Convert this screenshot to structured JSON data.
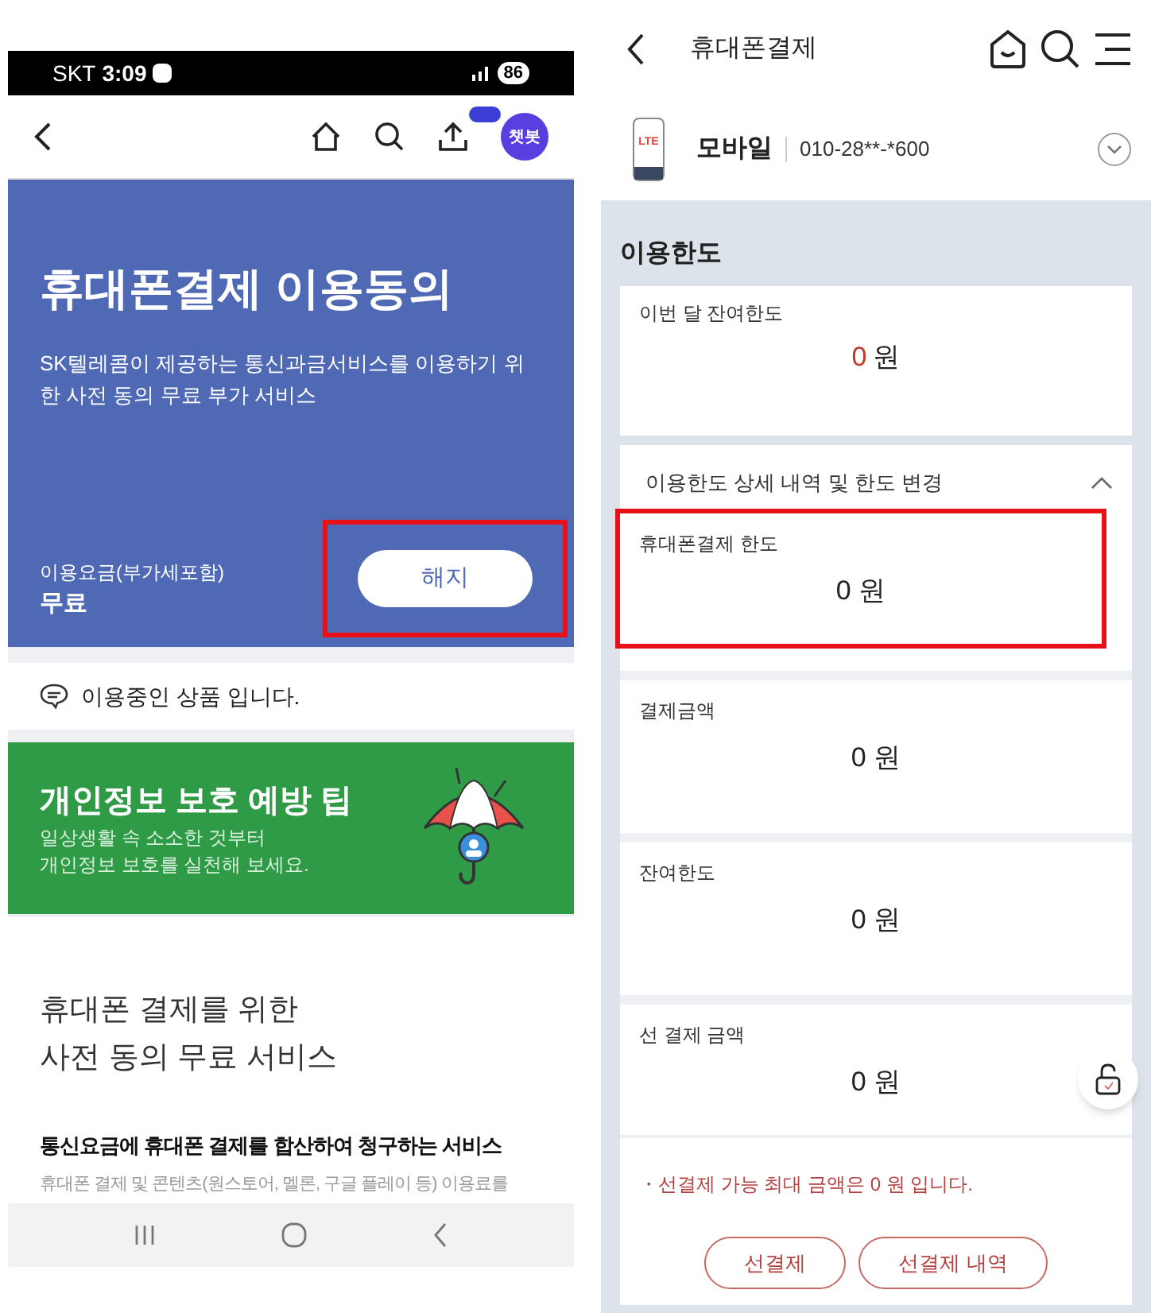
{
  "left": {
    "status_bar": {
      "carrier": "SKT",
      "time": "3:09",
      "battery": "86"
    },
    "header": {
      "chatbot": "챗봇"
    },
    "hero": {
      "title": "휴대폰결제 이용동의",
      "description": "SK텔레콤이 제공하는 통신과금서비스를 이용하기 위한 사전 동의 무료 부가 서비스",
      "fee_label": "이용요금(부가세포함)",
      "fee_value": "무료",
      "cancel_button": "해지",
      "highlighted": true
    },
    "notice": "이용중인 상품 입니다.",
    "tip": {
      "title": "개인정보 보호 예방 팁",
      "lines": [
        "일상생활 속 소소한 것부터",
        "개인정보 보호를 실천해 보세요."
      ]
    },
    "section": {
      "heading": [
        "휴대폰 결제를 위한",
        "사전 동의 무료 서비스"
      ],
      "subheading": "통신요금에 휴대폰 결제를 합산하여 청구하는 서비스",
      "body": "휴대폰 결제 및 콘텐츠(원스토어, 멜론, 구글 플레이 등) 이용료를"
    }
  },
  "right": {
    "header": {
      "title": "휴대폰결제"
    },
    "line": {
      "device": "LTE",
      "type": "모바일",
      "number": "010-28**-*600"
    },
    "limit": {
      "title": "이용한도",
      "current": {
        "label": "이번 달 잔여한도",
        "amount": "0",
        "unit": "원"
      },
      "detail": {
        "title": "이용한도 상세 내역 및 한도 변경",
        "expanded": true,
        "rows": [
          {
            "label": "휴대폰결제 한도",
            "amount": "0 원",
            "highlighted": true
          },
          {
            "label": "결제금액",
            "amount": "0 원",
            "highlighted": false
          },
          {
            "label": "잔여한도",
            "amount": "0 원",
            "highlighted": false
          },
          {
            "label": "선 결제 금액",
            "amount": "0 원",
            "highlighted": false
          }
        ]
      },
      "note": "・선결제 가능 최대 금액은 0 원 입니다.",
      "buttons": [
        "선결제",
        "선결제 내역"
      ]
    }
  }
}
